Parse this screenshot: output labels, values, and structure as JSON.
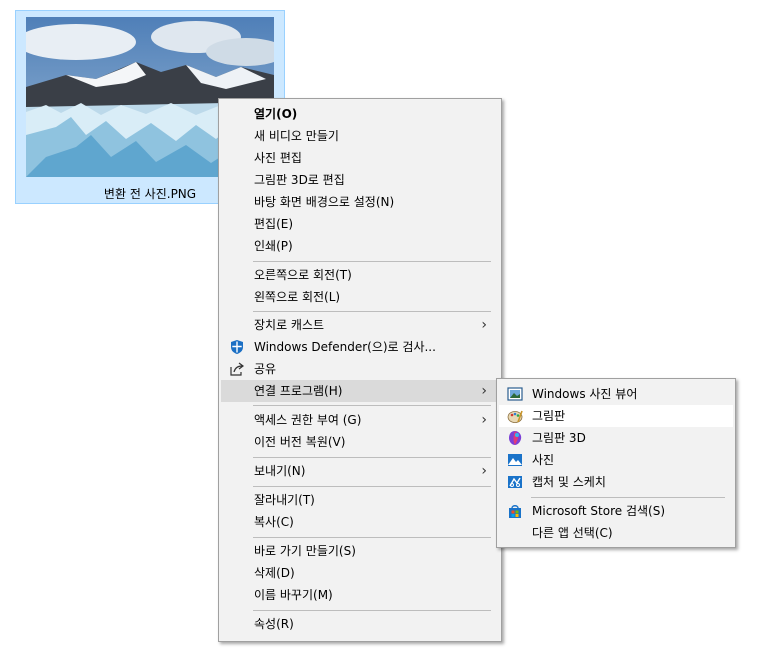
{
  "file": {
    "name": "변환 전 사진.PNG"
  },
  "context_menu": {
    "open": "열기(O)",
    "new_video": "새 비디오 만들기",
    "edit_photo": "사진 편집",
    "paint3d_edit": "그림판 3D로 편집",
    "set_wallpaper": "바탕 화면 배경으로 설정(N)",
    "edit": "편집(E)",
    "print": "인쇄(P)",
    "rotate_right": "오른쪽으로 회전(T)",
    "rotate_left": "왼쪽으로 회전(L)",
    "cast": "장치로 캐스트",
    "defender": "Windows Defender(으)로 검사...",
    "share": "공유",
    "open_with": "연결 프로그램(H)",
    "give_access": "액세스 권한 부여 (G)",
    "restore_prev": "이전 버전 복원(V)",
    "send_to": "보내기(N)",
    "cut": "잘라내기(T)",
    "copy": "복사(C)",
    "create_shortcut": "바로 가기 만들기(S)",
    "delete": "삭제(D)",
    "rename": "이름 바꾸기(M)",
    "properties": "속성(R)",
    "submenu_arrow": "›"
  },
  "open_with_menu": {
    "photo_viewer": "Windows 사진 뷰어",
    "paint": "그림판",
    "paint3d": "그림판 3D",
    "photos": "사진",
    "snip_sketch": "캡처 및 스케치",
    "store_search": "Microsoft Store 검색(S)",
    "choose_other": "다른 앱 선택(C)"
  },
  "icons": {
    "defender": "shield-icon",
    "share": "share-icon",
    "photo_viewer": "photo-viewer-icon",
    "paint": "paint-palette-icon",
    "paint3d": "paint3d-icon",
    "photos": "photos-icon",
    "snip_sketch": "snip-sketch-icon",
    "store": "store-icon"
  },
  "colors": {
    "selection": "#cce8ff",
    "menu_bg": "#f2f2f2",
    "hover": "#dadada",
    "accent": "#0078d7"
  }
}
